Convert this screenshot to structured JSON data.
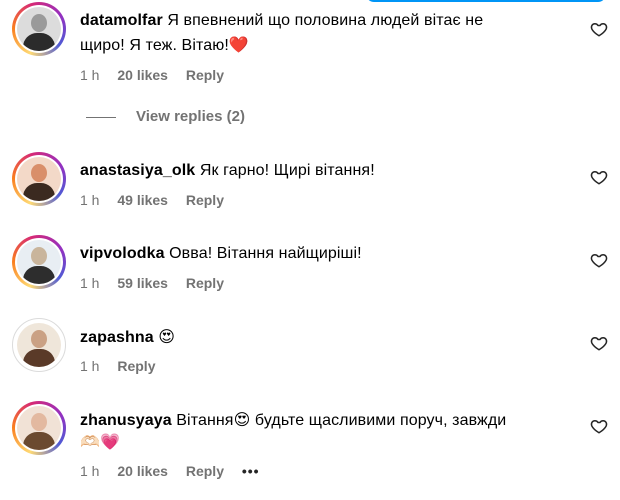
{
  "comments": [
    {
      "username": "datamolfar",
      "text_line1": "Я впевнений що половина людей вітає не",
      "text_line2": "щиро! Я теж. Вітаю!",
      "emoji": "❤️",
      "time": "1 h",
      "likes": "20 likes",
      "reply": "Reply",
      "avatar": {
        "ring": "story",
        "colors": [
          "#dcdcdc",
          "#2b2b2b",
          "#9a9a9a"
        ]
      }
    },
    {
      "username": "anastasiya_olk",
      "text_line1": "Як гарно! Щирі вітання!",
      "time": "1 h",
      "likes": "49 likes",
      "reply": "Reply",
      "avatar": {
        "ring": "story",
        "colors": [
          "#f3d9c8",
          "#3b2a20",
          "#d98f6a"
        ]
      }
    },
    {
      "username": "vipvolodka",
      "text_line1": "Овва! Вітання найщиріші!",
      "time": "1 h",
      "likes": "59 likes",
      "reply": "Reply",
      "avatar": {
        "ring": "story",
        "colors": [
          "#e8eef3",
          "#2d2d2d",
          "#c9b59c"
        ]
      }
    },
    {
      "username": "zapashna",
      "text_line1": "",
      "emoji": "😍",
      "time": "1 h",
      "reply": "Reply",
      "avatar": {
        "ring": "plain",
        "colors": [
          "#efe6da",
          "#5a3a28",
          "#caa184"
        ]
      }
    },
    {
      "username": "zhanusyaya",
      "text_line1": "Вітання",
      "emoji": "😍",
      "text_line1_rest": "будьте щасливими поруч, завжди",
      "text_line2_emoji": "🫶🏻💗",
      "time": "1 h",
      "likes": "20 likes",
      "reply": "Reply",
      "more": "•••",
      "avatar": {
        "ring": "story",
        "colors": [
          "#f1e2d6",
          "#6b4a30",
          "#e3b9a0"
        ]
      }
    }
  ],
  "view_replies": "View replies (2)",
  "colors": {
    "secondary_text": "#737373",
    "primary_text": "#000000",
    "accent": "#0095f6"
  },
  "icons": {
    "like": "heart-outline-icon",
    "more": "more-options-icon"
  }
}
